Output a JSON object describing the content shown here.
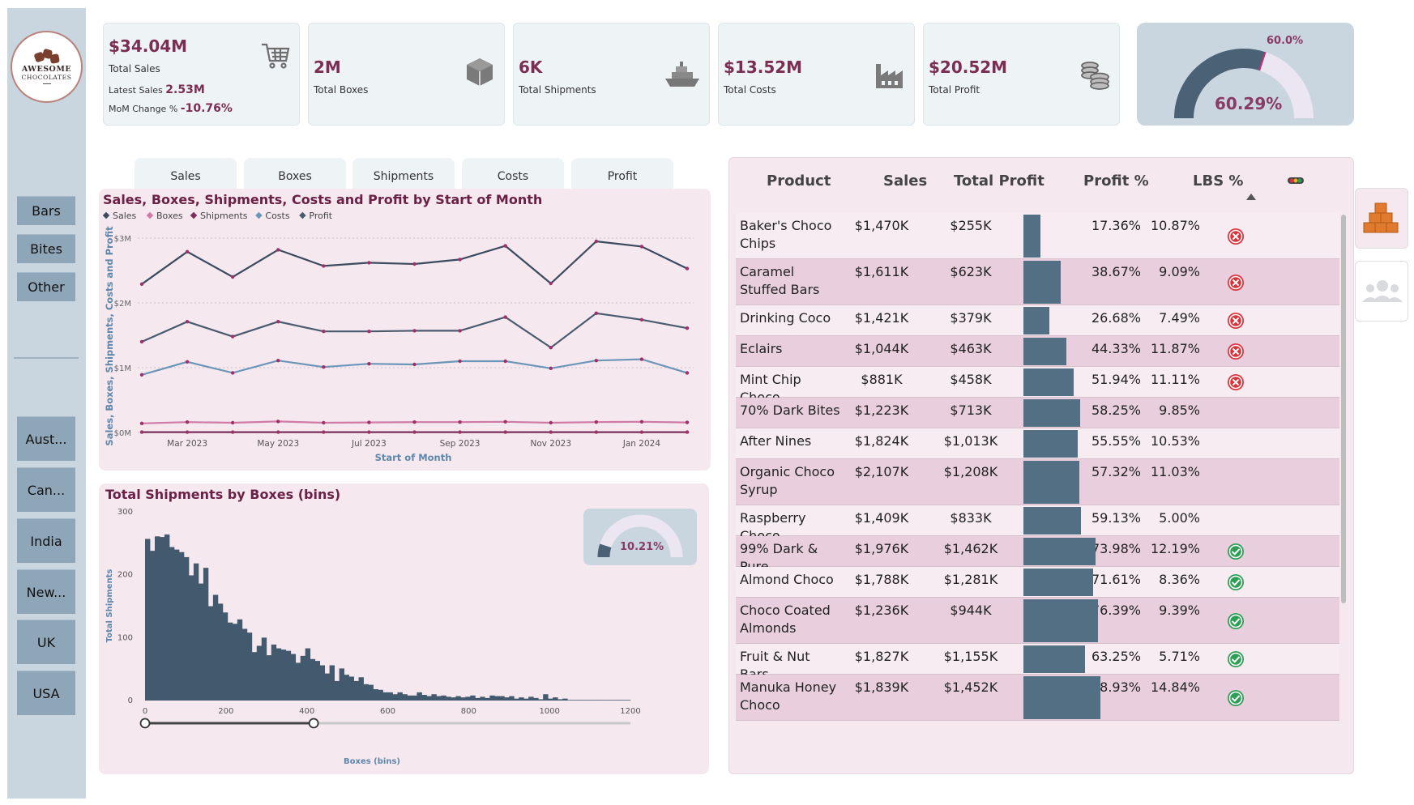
{
  "logo": {
    "line1": "AWESOME",
    "line2": "CHOCOLATES",
    "tagline": "Organic · Handcrafted"
  },
  "sidebar": {
    "categories": [
      "Bars",
      "Bites",
      "Other"
    ],
    "countries": [
      "Aust...",
      "Can...",
      "India",
      "New...",
      "UK",
      "USA"
    ]
  },
  "kpis": {
    "sales": {
      "value": "$34.04M",
      "label": "Total Sales",
      "latest_label": "Latest Sales",
      "latest_value": "2.53M",
      "mom_label": "MoM Change %",
      "mom_value": "-10.76%",
      "icon": "cart-icon"
    },
    "boxes": {
      "value": "2M",
      "label": "Total Boxes",
      "icon": "box-icon"
    },
    "shipments": {
      "value": "6K",
      "label": "Total Shipments",
      "icon": "ship-icon"
    },
    "costs": {
      "value": "$13.52M",
      "label": "Total Costs",
      "icon": "factory-icon"
    },
    "profit": {
      "value": "$20.52M",
      "label": "Total Profit",
      "icon": "coins-icon"
    }
  },
  "profit_gauge": {
    "value_label": "60.29%",
    "target_label": "60.0%",
    "value": 0.6029,
    "target": 0.6,
    "colors": {
      "fill": "#4b6176",
      "empty": "#ece6f3",
      "target": "#c7317a",
      "text": "#8a3a66"
    }
  },
  "tabs": [
    "Sales",
    "Boxes",
    "Shipments",
    "Costs",
    "Profit"
  ],
  "line_chart": {
    "title": "Sales, Boxes, Shipments, Costs and Profit by Start of Month",
    "legend": [
      "Sales",
      "Boxes",
      "Shipments",
      "Costs",
      "Profit"
    ],
    "xlabel": "Start of Month",
    "ylabel": "Sales, Boxes, Shipments, Costs and Profit",
    "y_ticks": [
      "$3M",
      "$2M",
      "$1M",
      "$0M"
    ],
    "x_ticks": [
      "Mar 2023",
      "May 2023",
      "Jul 2023",
      "Sep 2023",
      "Nov 2023",
      "Jan 2024"
    ]
  },
  "histogram": {
    "title": "Total Shipments by Boxes (bins)",
    "xlabel": "Boxes (bins)",
    "ylabel": "Total Shipments",
    "y_ticks": [
      "300",
      "200",
      "100",
      "0"
    ],
    "x_ticks": [
      "0",
      "200",
      "400",
      "600",
      "800",
      "1000",
      "1200"
    ],
    "mini_gauge_label": "10.21%",
    "mini_gauge_value": 0.1021,
    "slider": {
      "min": 0,
      "max": 1200,
      "selected": [
        0,
        417
      ]
    }
  },
  "chart_data": [
    {
      "type": "line",
      "title": "Sales, Boxes, Shipments, Costs and Profit by Start of Month",
      "xlabel": "Start of Month",
      "ylabel": "Sales, Boxes, Shipments, Costs and Profit",
      "x": [
        "2023-02",
        "2023-03",
        "2023-04",
        "2023-05",
        "2023-06",
        "2023-07",
        "2023-08",
        "2023-09",
        "2023-10",
        "2023-11",
        "2023-12",
        "2024-01",
        "2024-02"
      ],
      "ylim": [
        0,
        3000000
      ],
      "series": [
        {
          "name": "Sales",
          "color": "#3b4a5e",
          "values": [
            2290000,
            2790000,
            2400000,
            2820000,
            2570000,
            2620000,
            2600000,
            2670000,
            2880000,
            2300000,
            2950000,
            2870000,
            2530000
          ]
        },
        {
          "name": "Boxes",
          "color": "#d07aa6",
          "values": [
            140000,
            160000,
            150000,
            170000,
            150000,
            155000,
            160000,
            160000,
            165000,
            150000,
            160000,
            165000,
            155000
          ]
        },
        {
          "name": "Shipments",
          "color": "#7a2f5c",
          "values": [
            5000,
            5200,
            5000,
            5300,
            5100,
            5200,
            5100,
            5100,
            5300,
            5000,
            5300,
            5200,
            5100
          ]
        },
        {
          "name": "Costs",
          "color": "#6b96b8",
          "values": [
            890000,
            1090000,
            920000,
            1110000,
            1010000,
            1060000,
            1050000,
            1100000,
            1100000,
            990000,
            1110000,
            1130000,
            920000
          ]
        },
        {
          "name": "Profit",
          "color": "#4a5b70",
          "values": [
            1400000,
            1710000,
            1480000,
            1710000,
            1560000,
            1560000,
            1570000,
            1570000,
            1780000,
            1310000,
            1840000,
            1740000,
            1610000
          ]
        }
      ],
      "grid": true,
      "legend": "top-left"
    },
    {
      "type": "bar",
      "title": "Total Shipments by Boxes (bins)",
      "xlabel": "Boxes (bins)",
      "ylabel": "Total Shipments",
      "xlim": [
        0,
        1200
      ],
      "ylim": [
        0,
        300
      ],
      "bin_width": 12,
      "values": [
        257,
        238,
        261,
        260,
        264,
        244,
        240,
        236,
        228,
        199,
        218,
        186,
        211,
        150,
        168,
        154,
        140,
        124,
        122,
        129,
        114,
        108,
        77,
        87,
        100,
        72,
        89,
        83,
        81,
        79,
        74,
        60,
        71,
        83,
        66,
        63,
        56,
        43,
        56,
        31,
        51,
        41,
        38,
        31,
        37,
        26,
        25,
        18,
        17,
        13,
        13,
        10,
        13,
        10,
        8,
        8,
        13,
        9,
        7,
        10,
        7,
        8,
        6,
        5,
        7,
        5,
        6,
        8,
        4,
        6,
        4,
        8,
        7,
        7,
        5,
        7,
        3,
        5,
        3,
        6,
        4,
        2,
        10,
        3,
        5,
        2,
        3,
        1,
        1,
        1,
        1,
        1,
        1,
        1,
        1,
        1,
        1,
        1,
        1,
        1
      ]
    }
  ],
  "table": {
    "headers": [
      "Product",
      "Sales",
      "Total Profit",
      "Profit %",
      "LBS %"
    ],
    "rows": [
      {
        "product": "Baker's Choco Chips",
        "sales": "$1,470K",
        "profit": "$255K",
        "pct": "17.36%",
        "pct_value": 17.36,
        "lbs": "10.87%",
        "status": "bad"
      },
      {
        "product": "Caramel Stuffed Bars",
        "sales": "$1,611K",
        "profit": "$623K",
        "pct": "38.67%",
        "pct_value": 38.67,
        "lbs": "9.09%",
        "status": "bad"
      },
      {
        "product": "Drinking Coco",
        "sales": "$1,421K",
        "profit": "$379K",
        "pct": "26.68%",
        "pct_value": 26.68,
        "lbs": "7.49%",
        "status": "bad"
      },
      {
        "product": "Eclairs",
        "sales": "$1,044K",
        "profit": "$463K",
        "pct": "44.33%",
        "pct_value": 44.33,
        "lbs": "11.87%",
        "status": "bad"
      },
      {
        "product": "Mint Chip Choco",
        "sales": "$881K",
        "profit": "$458K",
        "pct": "51.94%",
        "pct_value": 51.94,
        "lbs": "11.11%",
        "status": "bad"
      },
      {
        "product": "70% Dark Bites",
        "sales": "$1,223K",
        "profit": "$713K",
        "pct": "58.25%",
        "pct_value": 58.25,
        "lbs": "9.85%",
        "status": ""
      },
      {
        "product": "After Nines",
        "sales": "$1,824K",
        "profit": "$1,013K",
        "pct": "55.55%",
        "pct_value": 55.55,
        "lbs": "10.53%",
        "status": ""
      },
      {
        "product": "Organic Choco Syrup",
        "sales": "$2,107K",
        "profit": "$1,208K",
        "pct": "57.32%",
        "pct_value": 57.32,
        "lbs": "11.03%",
        "status": ""
      },
      {
        "product": "Raspberry Choco",
        "sales": "$1,409K",
        "profit": "$833K",
        "pct": "59.13%",
        "pct_value": 59.13,
        "lbs": "5.00%",
        "status": ""
      },
      {
        "product": "99% Dark & Pure",
        "sales": "$1,976K",
        "profit": "$1,462K",
        "pct": "73.98%",
        "pct_value": 73.98,
        "lbs": "12.19%",
        "status": "good"
      },
      {
        "product": "Almond Choco",
        "sales": "$1,788K",
        "profit": "$1,281K",
        "pct": "71.61%",
        "pct_value": 71.61,
        "lbs": "8.36%",
        "status": "good"
      },
      {
        "product": "Choco Coated Almonds",
        "sales": "$1,236K",
        "profit": "$944K",
        "pct": "76.39%",
        "pct_value": 76.39,
        "lbs": "9.39%",
        "status": "good"
      },
      {
        "product": "Fruit & Nut Bars",
        "sales": "$1,827K",
        "profit": "$1,155K",
        "pct": "63.25%",
        "pct_value": 63.25,
        "lbs": "5.71%",
        "status": "good"
      },
      {
        "product": "Manuka Honey Choco",
        "sales": "$1,839K",
        "profit": "$1,452K",
        "pct": "78.93%",
        "pct_value": 78.93,
        "lbs": "14.84%",
        "status": "good"
      }
    ]
  },
  "colors": {
    "accent": "#7b2e52",
    "panel": "#f5e8ef",
    "bar": "#536f84",
    "good": "#2e9e55",
    "bad": "#d9343c"
  }
}
